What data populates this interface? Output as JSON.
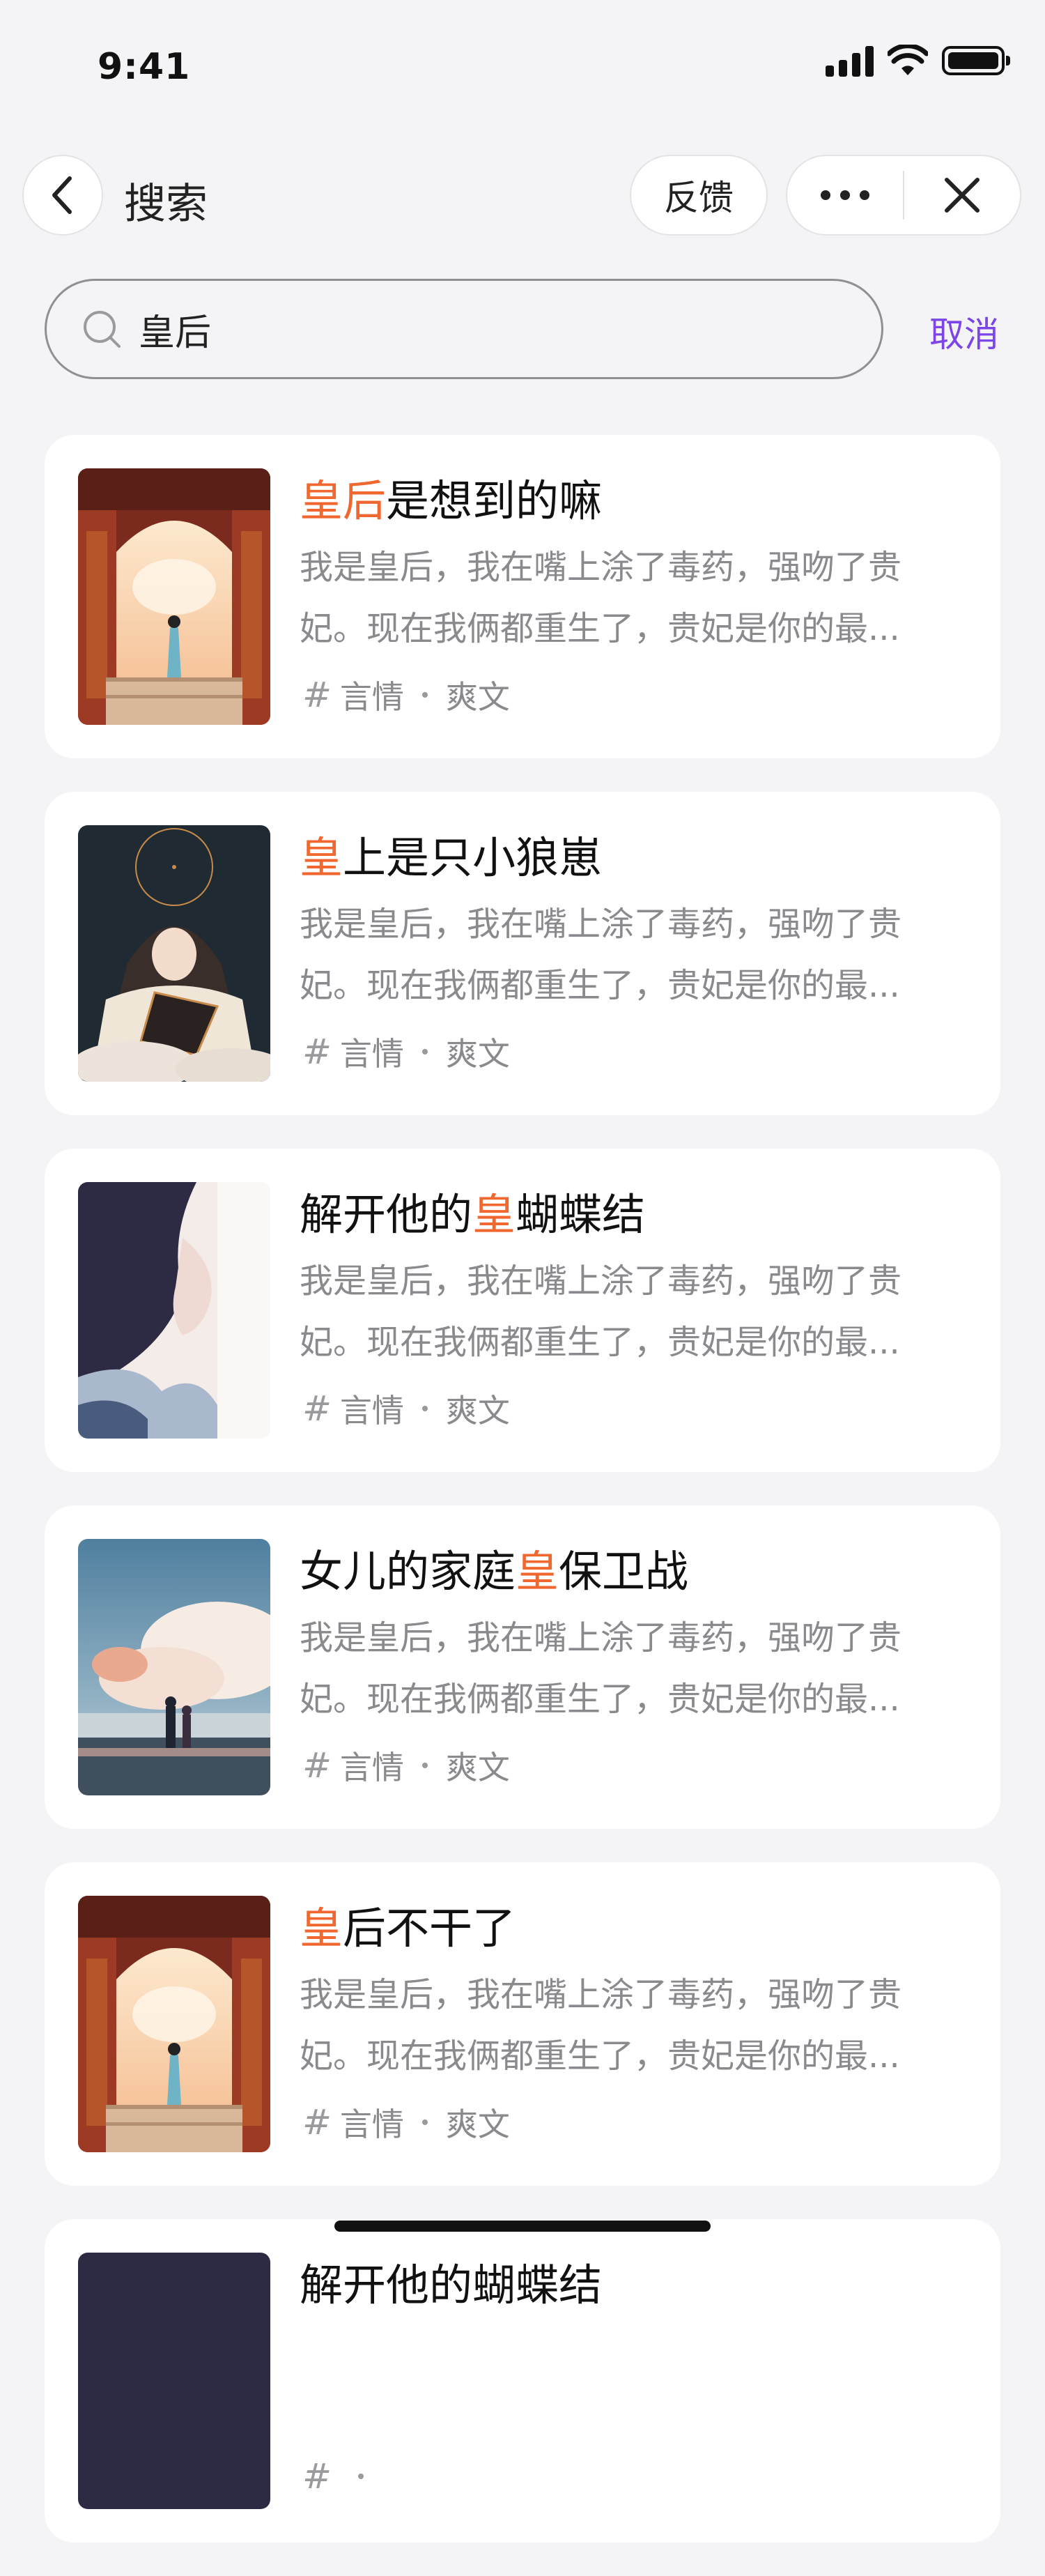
{
  "status_bar": {
    "time": "9:41"
  },
  "nav": {
    "title": "搜索",
    "feedback_label": "反馈"
  },
  "search": {
    "query": "皇后",
    "cancel_label": "取消"
  },
  "colors": {
    "highlight": "#f06830",
    "accent": "#7b45e8",
    "muted": "#8a8a8e"
  },
  "results": [
    {
      "title_pre": "",
      "title_hl": "皇后",
      "title_post": "是想到的嘛",
      "desc_line1": "我是皇后，我在嘴上涂了毒药，强吻了贵",
      "desc_line2": "妃。现在我俩都重生了，贵妃是你的最...",
      "tag1": "言情",
      "tag2": "爽文",
      "cover": "palace-gate"
    },
    {
      "title_pre": "",
      "title_hl": "皇",
      "title_post": "上是只小狼崽",
      "desc_line1": "我是皇后，我在嘴上涂了毒药，强吻了贵",
      "desc_line2": "妃。现在我俩都重生了，贵妃是你的最...",
      "tag1": "言情",
      "tag2": "爽文",
      "cover": "sleeping-girl"
    },
    {
      "title_pre": "解开他的",
      "title_hl": "皇",
      "title_post": "蝴蝶结",
      "desc_line1": "我是皇后，我在嘴上涂了毒药，强吻了贵",
      "desc_line2": "妃。现在我俩都重生了，贵妃是你的最...",
      "tag1": "言情",
      "tag2": "爽文",
      "cover": "girl-profile"
    },
    {
      "title_pre": "女儿的家庭",
      "title_hl": "皇",
      "title_post": "保卫战",
      "desc_line1": "我是皇后，我在嘴上涂了毒药，强吻了贵",
      "desc_line2": "妃。现在我俩都重生了，贵妃是你的最...",
      "tag1": "言情",
      "tag2": "爽文",
      "cover": "beach-clouds"
    },
    {
      "title_pre": "",
      "title_hl": "皇",
      "title_post": "后不干了",
      "desc_line1": "我是皇后，我在嘴上涂了毒药，强吻了贵",
      "desc_line2": "妃。现在我俩都重生了，贵妃是你的最...",
      "tag1": "言情",
      "tag2": "爽文",
      "cover": "palace-gate"
    },
    {
      "title_pre": "解开他的",
      "title_hl": "",
      "title_post": "蝴蝶结",
      "desc_line1": "",
      "desc_line2": "",
      "tag1": "",
      "tag2": "",
      "cover": "dark"
    }
  ]
}
